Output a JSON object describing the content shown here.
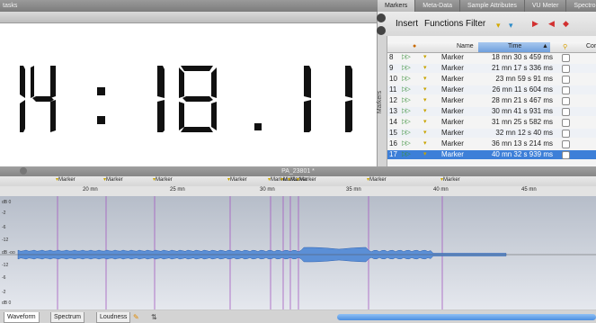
{
  "top_left_bar": {
    "label": "tasks"
  },
  "clock": {
    "hours": "14",
    "minutes": "18",
    "fraction": "11"
  },
  "tabs": [
    "Markers",
    "Meta-Data",
    "Sample Attributes",
    "VU Meter",
    "Spectro"
  ],
  "marker_toolbar": {
    "insert": "Insert",
    "functions": "Functions",
    "filter": "Filter"
  },
  "sidebar_label": "Markers",
  "table": {
    "columns": [
      "Name",
      "Time",
      "Cor"
    ],
    "rows": [
      {
        "num": "8",
        "name": "Marker",
        "time": "18 mn 30 s 459 ms"
      },
      {
        "num": "9",
        "name": "Marker",
        "time": "21 mn 17 s 336 ms"
      },
      {
        "num": "10",
        "name": "Marker",
        "time": "23 mn 59 s 91 ms"
      },
      {
        "num": "11",
        "name": "Marker",
        "time": "26 mn 11 s 604 ms"
      },
      {
        "num": "12",
        "name": "Marker",
        "time": "28 mn 21 s 467 ms"
      },
      {
        "num": "13",
        "name": "Marker",
        "time": "30 mn 41 s 931 ms"
      },
      {
        "num": "14",
        "name": "Marker",
        "time": "31 mn 25 s 582 ms"
      },
      {
        "num": "15",
        "name": "Marker",
        "time": "32 mn 12 s 40 ms"
      },
      {
        "num": "16",
        "name": "Marker",
        "time": "36 mn 13 s 214 ms"
      },
      {
        "num": "17",
        "name": "Marker",
        "time": "40 mn 32 s 939 ms",
        "selected": true
      }
    ]
  },
  "wave_window": {
    "title": "PA_23801 *",
    "marker_labels": [
      "Marker",
      "Marker",
      "Marker",
      "Marker",
      "Marker",
      "Marker",
      "Marker",
      "Marker",
      "Marker",
      "Marker"
    ],
    "ruler_labels": [
      "20 mn",
      "25 mn",
      "30 mn",
      "35 mn",
      "40 mn",
      "45 mn"
    ],
    "db_labels": [
      "dB 0",
      "-2",
      "-6",
      "-12",
      "dB -oo",
      "-12",
      "-6",
      "-2",
      "dB 0"
    ],
    "bottom_tabs": [
      "Waveform",
      "Spectrum",
      "Loudness"
    ]
  }
}
